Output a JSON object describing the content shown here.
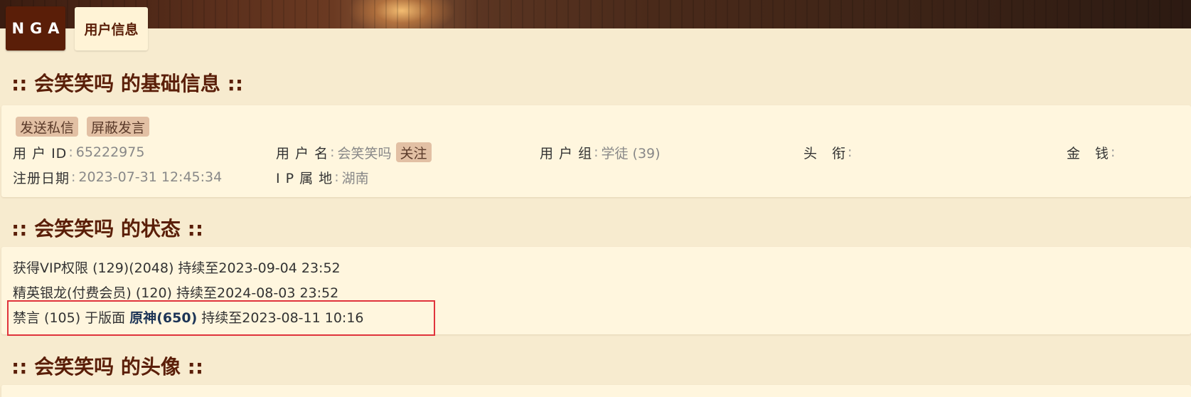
{
  "header": {
    "logo_text": "NGA",
    "tab_label": "用户信息"
  },
  "basic_info": {
    "title": ":: 会笑笑吗 的基础信息 ::",
    "buttons": {
      "send_message": "发送私信",
      "block_posts": "屏蔽发言",
      "follow": "关注"
    },
    "fields": {
      "user_id_label": "用 户 ID",
      "user_id_value": "65222975",
      "username_label": "用 户 名",
      "username_value": "会笑笑吗",
      "group_label": "用 户 组",
      "group_value": "学徒 (39)",
      "title_label": "头　衔",
      "title_value": "",
      "money_label": "金　钱",
      "money_value": "",
      "register_label": "注册日期",
      "register_value": "2023-07-31 12:45:34",
      "ip_label": "I P 属 地",
      "ip_value": "湖南",
      "separator": ":"
    }
  },
  "status": {
    "title": ":: 会笑笑吗 的状态 ::",
    "lines": [
      {
        "text": "获得VIP权限 (129)(2048) 持续至2023-09-04 23:52"
      },
      {
        "text": "精英银龙(付费会员) (120) 持续至2024-08-03 23:52"
      },
      {
        "prefix": "禁言 (105) 于版面 ",
        "forum": "原神(650)",
        "suffix": " 持续至2023-08-11 10:16"
      }
    ]
  },
  "avatar": {
    "title": ":: 会笑笑吗 的头像 ::"
  },
  "colors": {
    "background": "#f7ebcf",
    "panel": "#fff6de",
    "title_brown": "#5a1e08",
    "button_bg": "#e2c0a4",
    "highlight_border": "#e0343c",
    "forum_link": "#1d3557"
  }
}
